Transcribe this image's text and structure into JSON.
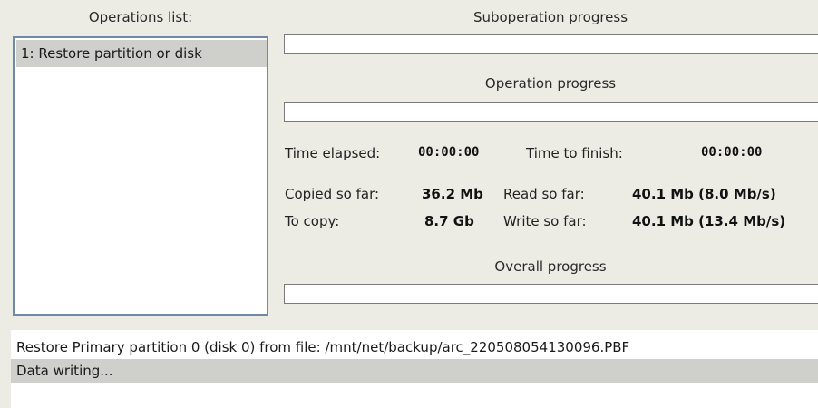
{
  "operations": {
    "header": "Operations list:",
    "items": [
      {
        "label": "1: Restore partition or disk"
      }
    ]
  },
  "suboperation": {
    "header": "Suboperation progress",
    "progress": 0
  },
  "operation": {
    "header": "Operation progress",
    "progress": 0
  },
  "stats": {
    "time_elapsed_label": "Time elapsed:",
    "time_elapsed": "00:00:00",
    "time_to_finish_label": "Time to finish:",
    "time_to_finish": "00:00:00",
    "copied_label": "Copied so far:",
    "copied": "36.2 Mb",
    "to_copy_label": "To copy:",
    "to_copy": "8.7 Gb",
    "read_label": "Read so far:",
    "read": "40.1 Mb (8.0 Mb/s)",
    "write_label": "Write so far:",
    "write": "40.1 Mb (13.4 Mb/s)"
  },
  "overall": {
    "header": "Overall progress",
    "progress": 0
  },
  "log": {
    "lines": [
      "Restore Primary partition 0 (disk 0) from file: /mnt/net/backup/arc_220508054130096.PBF",
      "Data writing..."
    ]
  }
}
